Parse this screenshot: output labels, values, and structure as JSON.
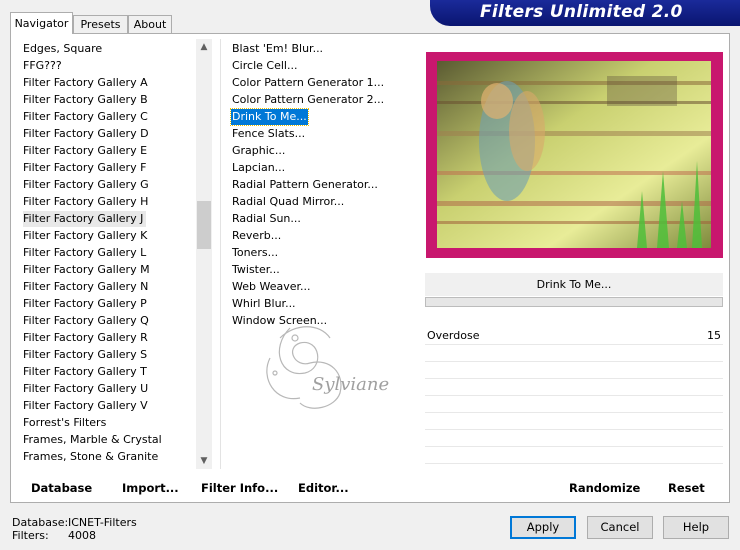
{
  "tabs": [
    "Navigator",
    "Presets",
    "About"
  ],
  "banner_title": "Filters Unlimited 2.0",
  "categories": [
    "Edges, Square",
    "FFG???",
    "Filter Factory Gallery A",
    "Filter Factory Gallery B",
    "Filter Factory Gallery C",
    "Filter Factory Gallery D",
    "Filter Factory Gallery E",
    "Filter Factory Gallery F",
    "Filter Factory Gallery G",
    "Filter Factory Gallery H",
    "Filter Factory Gallery J",
    "Filter Factory Gallery K",
    "Filter Factory Gallery L",
    "Filter Factory Gallery M",
    "Filter Factory Gallery N",
    "Filter Factory Gallery P",
    "Filter Factory Gallery Q",
    "Filter Factory Gallery R",
    "Filter Factory Gallery S",
    "Filter Factory Gallery T",
    "Filter Factory Gallery U",
    "Filter Factory Gallery V",
    "Forrest's Filters",
    "Frames, Marble & Crystal",
    "Frames, Stone & Granite"
  ],
  "selected_category": "Filter Factory Gallery J",
  "filters": [
    "Blast 'Em! Blur...",
    "Circle Cell...",
    "Color Pattern Generator 1...",
    "Color Pattern Generator 2...",
    "Drink To Me...",
    "Fence Slats...",
    "Graphic...",
    "Lapcian...",
    "Radial Pattern Generator...",
    "Radial Quad Mirror...",
    "Radial Sun...",
    "Reverb...",
    "Toners...",
    "Twister...",
    "Web Weaver...",
    "Whirl Blur...",
    "Window Screen..."
  ],
  "selected_filter": "Drink To Me...",
  "preview": {
    "frame_color": "#c8176e"
  },
  "current_filter_name": "Drink To Me...",
  "parameters": [
    {
      "name": "Overdose",
      "value": "15"
    }
  ],
  "bottom_buttons": {
    "database": "Database",
    "import": "Import...",
    "filter_info": "Filter Info...",
    "editor": "Editor...",
    "randomize": "Randomize",
    "reset": "Reset"
  },
  "status": {
    "database_label": "Database:",
    "database_value": "ICNET-Filters",
    "filters_label": "Filters:",
    "filters_value": "4008"
  },
  "dialog_buttons": {
    "apply": "Apply",
    "cancel": "Cancel",
    "help": "Help"
  },
  "watermark_text": "Sylviane",
  "colors": {
    "selection": "#0078d7",
    "banner": "#0a1570",
    "accent": "#c8176e"
  }
}
